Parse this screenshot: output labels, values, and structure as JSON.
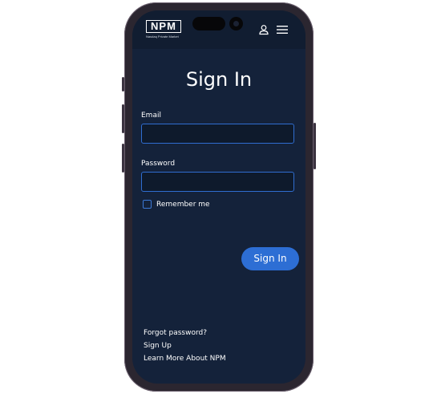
{
  "header": {
    "logo_text": "NPM",
    "logo_subtext": "Nasdaq Private Market",
    "user_icon": "user-icon",
    "menu_icon": "hamburger-menu-icon"
  },
  "form": {
    "title": "Sign In",
    "email_label": "Email",
    "email_value": "",
    "password_label": "Password",
    "password_value": "",
    "remember_label": "Remember me",
    "remember_checked": false,
    "submit_label": "Sign In"
  },
  "links": {
    "forgot_password": "Forgot password?",
    "sign_up": "Sign Up",
    "learn_more": "Learn More About NPM"
  },
  "colors": {
    "background": "#14223a",
    "header": "#111d31",
    "accent": "#2d6ed4",
    "input_border": "#2f6dd0"
  }
}
